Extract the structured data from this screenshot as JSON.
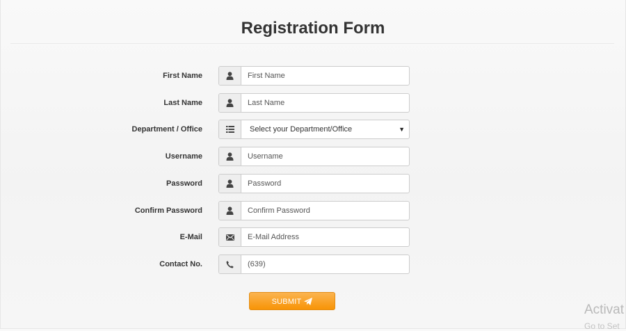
{
  "form": {
    "title": "Registration Form",
    "fields": [
      {
        "label": "First Name",
        "placeholder": "First Name",
        "icon": "user-icon"
      },
      {
        "label": "Last Name",
        "placeholder": "Last Name",
        "icon": "user-icon"
      },
      {
        "label": "Department / Office",
        "selected": "Select your Department/Office",
        "icon": "list-icon"
      },
      {
        "label": "Username",
        "placeholder": "Username",
        "icon": "user-icon"
      },
      {
        "label": "Password",
        "placeholder": "Password",
        "icon": "user-icon"
      },
      {
        "label": "Confirm Password",
        "placeholder": "Confirm Password",
        "icon": "user-icon"
      },
      {
        "label": "E-Mail",
        "placeholder": "E-Mail Address",
        "icon": "envelope-icon"
      },
      {
        "label": "Contact No.",
        "placeholder": "(639)",
        "icon": "phone-icon"
      }
    ],
    "submit_label": "SUBMIT",
    "submit_icon": "send-icon",
    "accent_color": "#f89406"
  },
  "watermark": {
    "line1": "Activat",
    "line2": "Go to Set"
  }
}
